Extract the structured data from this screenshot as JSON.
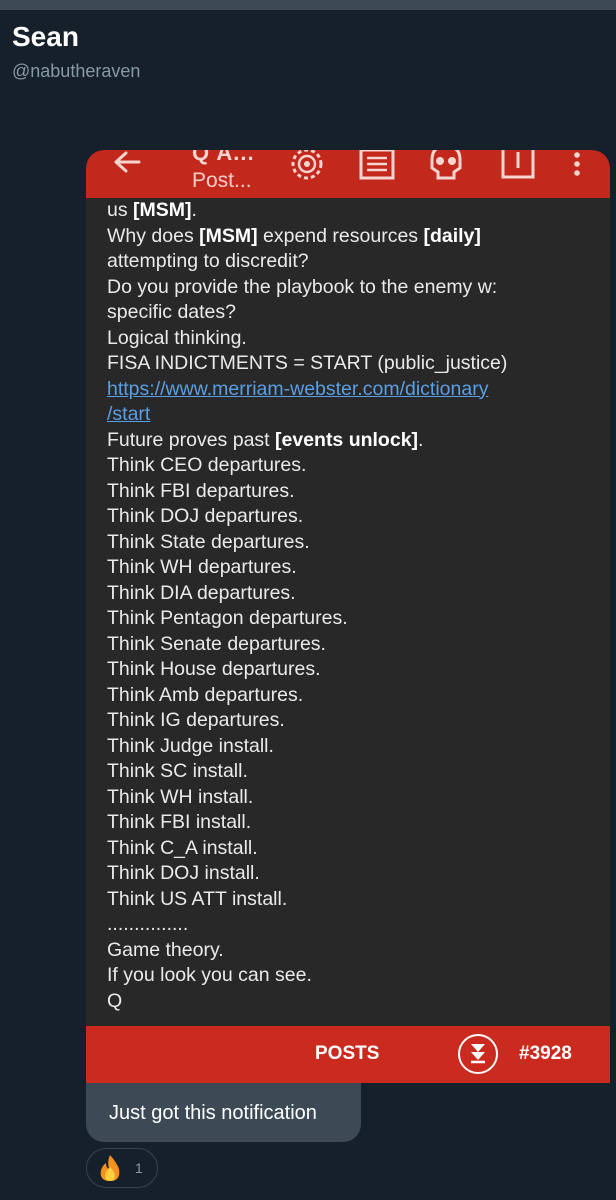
{
  "sender": {
    "name": "Sean",
    "handle": "@nabutheraven"
  },
  "app_bar": {
    "title": "Q A...",
    "subtitle": "Post...",
    "icons": [
      "back-arrow-icon",
      "gear-icon",
      "document-icon",
      "skull-icon",
      "share-icon",
      "more-vertical-icon"
    ]
  },
  "post": {
    "lines": [
      [
        {
          "t": "us "
        },
        {
          "t": "[MSM]",
          "b": true
        },
        {
          "t": "."
        }
      ],
      [
        {
          "t": "Why does "
        },
        {
          "t": "[MSM]",
          "b": true
        },
        {
          "t": " expend resources "
        },
        {
          "t": "[daily]",
          "b": true
        }
      ],
      [
        {
          "t": "attempting to discredit?"
        }
      ],
      [
        {
          "t": "Do you provide the playbook to the enemy w:"
        }
      ],
      [
        {
          "t": "specific dates?"
        }
      ],
      [
        {
          "t": "Logical thinking."
        }
      ],
      [
        {
          "t": "FISA INDICTMENTS = START (public_justice)"
        }
      ],
      [
        {
          "t": "https://www.merriam-webster.com/dictionary",
          "link": true
        }
      ],
      [
        {
          "t": "/start",
          "link": true
        }
      ],
      [
        {
          "t": "Future proves past "
        },
        {
          "t": "[events unlock]",
          "b": true
        },
        {
          "t": "."
        }
      ],
      [
        {
          "t": "Think CEO departures."
        }
      ],
      [
        {
          "t": "Think FBI departures."
        }
      ],
      [
        {
          "t": "Think DOJ departures."
        }
      ],
      [
        {
          "t": "Think State departures."
        }
      ],
      [
        {
          "t": "Think WH departures."
        }
      ],
      [
        {
          "t": "Think DIA departures."
        }
      ],
      [
        {
          "t": "Think Pentagon departures."
        }
      ],
      [
        {
          "t": "Think Senate departures."
        }
      ],
      [
        {
          "t": "Think House departures."
        }
      ],
      [
        {
          "t": "Think Amb departures."
        }
      ],
      [
        {
          "t": "Think IG departures."
        }
      ],
      [
        {
          "t": "Think Judge install."
        }
      ],
      [
        {
          "t": "Think SC install."
        }
      ],
      [
        {
          "t": "Think WH install."
        }
      ],
      [
        {
          "t": "Think FBI install."
        }
      ],
      [
        {
          "t": "Think C_A install."
        }
      ],
      [
        {
          "t": "Think DOJ install."
        }
      ],
      [
        {
          "t": "Think US ATT install."
        }
      ],
      [
        {
          "t": "..............."
        }
      ],
      [
        {
          "t": "Game theory."
        }
      ],
      [
        {
          "t": "If you look you can see."
        }
      ],
      [
        {
          "t": "Q"
        }
      ]
    ]
  },
  "bottom_bar": {
    "posts_label": "POSTS",
    "post_number": "#3928",
    "icon": "scroll-down-icon"
  },
  "caption": "Just got this notification",
  "reaction": {
    "emoji": "fire-icon",
    "count": "1"
  },
  "colors": {
    "background": "#15202b",
    "app_red": "#c2281b",
    "post_bg": "#282828",
    "link": "#5a9fe6",
    "bubble": "#3d4a56"
  }
}
